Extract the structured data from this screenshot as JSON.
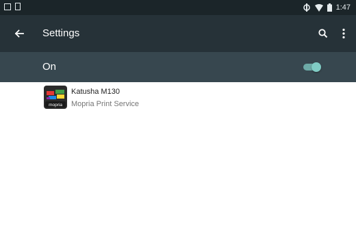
{
  "status_bar": {
    "time": "1:47",
    "left_icons": [
      "screenshot-icon",
      "sim-card-icon"
    ],
    "right_icons": [
      "data-sync-icon",
      "wifi-icon",
      "battery-icon"
    ]
  },
  "toolbar": {
    "title": "Settings",
    "back_icon": "arrow-back-icon",
    "search_icon": "search-icon",
    "more_icon": "more-vert-icon"
  },
  "master_switch": {
    "label": "On",
    "checked": true
  },
  "print_services": [
    {
      "title": "Katusha M130",
      "subtitle": "Mopria Print Service",
      "icon_text": "mopria"
    }
  ],
  "colors": {
    "status_bar": "#1b2529",
    "toolbar": "#263238",
    "switch_bar": "#37474f",
    "accent": "#80cbc4",
    "background": "#ffffff"
  }
}
